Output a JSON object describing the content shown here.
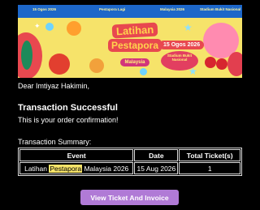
{
  "banner": {
    "strip_texts": [
      "15 Ogos 2026",
      "Pestapora Lagi",
      "Malaysia 2026",
      "Stadium Bukit Nasional"
    ],
    "title_line1": "Latihan",
    "title_line2": "Pestapora",
    "title_line3": "Malaysia",
    "date_badge": "15 Ogos 2026",
    "venue_badge": "Stadium Bukit Nasional",
    "colors": {
      "background": "#f6e36a",
      "strip": "#1d67c9",
      "accent": "#e8484f"
    }
  },
  "email": {
    "greeting": "Dear Imtiyaz Hakimin,",
    "heading": "Transaction Successful",
    "subtext": "This is your order confirmation!",
    "summary_label": "Transaction Summary:"
  },
  "table": {
    "headers": [
      "Event",
      "Date",
      "Total Ticket(s)"
    ],
    "row": {
      "event_prefix": "Latihan ",
      "event_highlight": "Pestapora",
      "event_suffix": " Malaysia 2026",
      "date": "15 Aug 2026",
      "tickets": "1"
    }
  },
  "cta": {
    "label": "View Ticket And Invoice",
    "color": "#b07ad6"
  }
}
